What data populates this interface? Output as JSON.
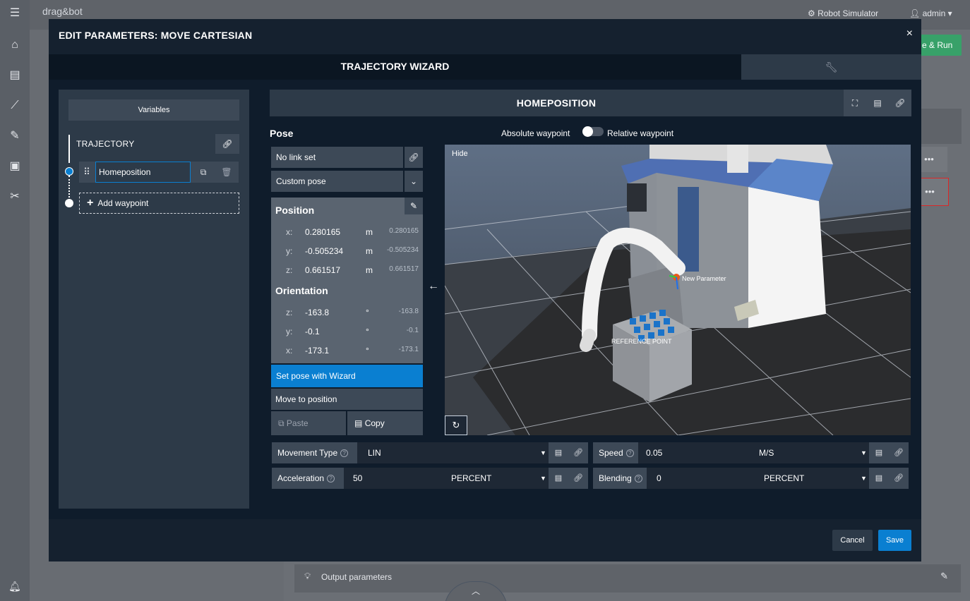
{
  "app": {
    "logo": "drag&bot",
    "robot": "Robot Simulator",
    "user": "admin",
    "run_label": "e & Run",
    "output_params": "Output parameters"
  },
  "modal": {
    "title": "EDIT PARAMETERS: MOVE CARTESIAN",
    "close": "×",
    "tab_wizard": "TRAJECTORY WIZARD",
    "cancel": "Cancel",
    "save": "Save"
  },
  "left": {
    "variables": "Variables",
    "trajectory": "TRAJECTORY",
    "waypoint_value": "Homeposition",
    "add_waypoint": "Add waypoint"
  },
  "main": {
    "waypoint_title": "HOMEPOSITION",
    "pose": "Pose",
    "absolute": "Absolute waypoint",
    "relative": "Relative waypoint",
    "link": "No link set",
    "custom_pose": "Custom pose",
    "position": "Position",
    "orientation": "Orientation",
    "pos": [
      {
        "axis": "x:",
        "value": "0.280165",
        "unit": "m",
        "ref": "0.280165"
      },
      {
        "axis": "y:",
        "value": "-0.505234",
        "unit": "m",
        "ref": "-0.505234"
      },
      {
        "axis": "z:",
        "value": "0.661517",
        "unit": "m",
        "ref": "0.661517"
      }
    ],
    "ori": [
      {
        "axis": "z:",
        "value": "-163.8",
        "unit": "°",
        "ref": "-163.8"
      },
      {
        "axis": "y:",
        "value": "-0.1",
        "unit": "°",
        "ref": "-0.1"
      },
      {
        "axis": "x:",
        "value": "-173.1",
        "unit": "°",
        "ref": "-173.1"
      }
    ],
    "set_wizard": "Set pose with Wizard",
    "move_to": "Move to position",
    "paste": "Paste",
    "copy": "Copy",
    "hide": "Hide",
    "scene_label_1": "New Parameter",
    "scene_label_2": "REFERENCE POINT"
  },
  "params": {
    "movement_type": {
      "label": "Movement Type",
      "value": "LIN"
    },
    "speed": {
      "label": "Speed",
      "value": "0.05",
      "unit": "M/S"
    },
    "acceleration": {
      "label": "Acceleration",
      "value": "50",
      "unit": "PERCENT"
    },
    "blending": {
      "label": "Blending",
      "value": "0",
      "unit": "PERCENT"
    }
  },
  "colors": {
    "accent": "#0a7fd1",
    "modal_bg": "#0f1c2b",
    "panel": "#2d3a48",
    "run_green": "#38a169"
  }
}
